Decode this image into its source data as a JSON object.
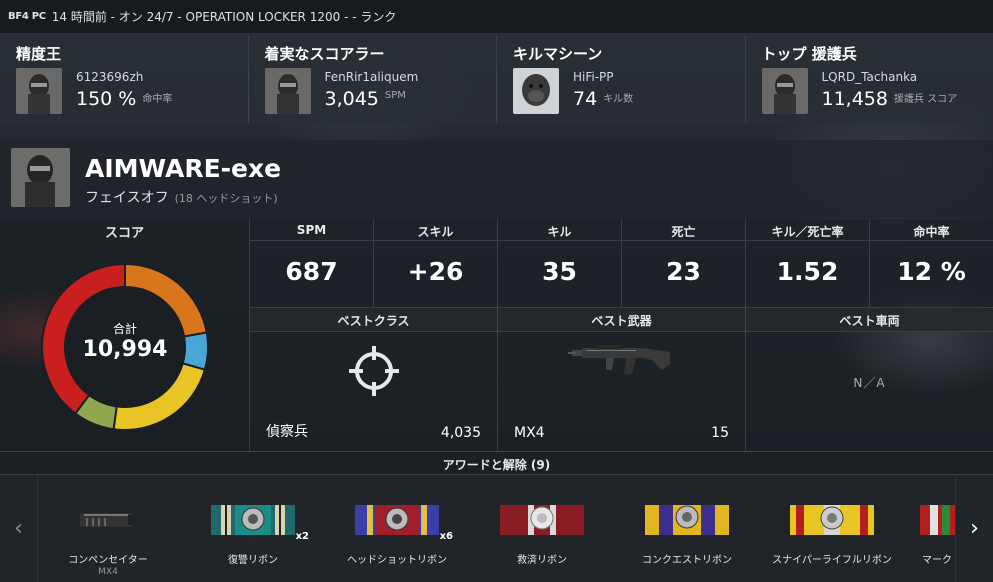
{
  "topbar": {
    "logo": "BF4 PC",
    "text": "14 時間前 - オン 24/7 - OPERATION LOCKER 1200 - - ランク"
  },
  "top_awards": [
    {
      "title": "精度王",
      "player": "6123696zh",
      "value": "150 %",
      "unit": "命中率",
      "avatar": "soldier-avatar"
    },
    {
      "title": "着実なスコアラー",
      "player": "FenRir1aliquem",
      "value": "3,045",
      "unit": "SPM",
      "avatar": "soldier-avatar"
    },
    {
      "title": "キルマシーン",
      "player": "HiFi-PP",
      "value": "74",
      "unit": "キル数",
      "avatar": "gorilla-avatar"
    },
    {
      "title": "トップ 援護兵",
      "player": "LQRD_Tachanka",
      "value": "11,458",
      "unit": "援護兵 スコア",
      "avatar": "soldier-avatar"
    }
  ],
  "player": {
    "name": "AIMWARE-exe",
    "subtitle": "フェイスオフ",
    "subtitle_note": "(18 ヘッドショット)"
  },
  "score": {
    "header": "スコア",
    "total_label": "合計",
    "total": "10,994"
  },
  "chart_data": {
    "type": "pie",
    "title": "",
    "center_label": "合計",
    "center_value": 10994,
    "slices": [
      {
        "fraction": 0.222,
        "color": "#d9761c"
      },
      {
        "fraction": 0.072,
        "color": "#4aa6d6"
      },
      {
        "fraction": 0.228,
        "color": "#e8c425"
      },
      {
        "fraction": 0.08,
        "color": "#8fa84f"
      },
      {
        "fraction": 0.398,
        "color": "#c9201f"
      }
    ]
  },
  "stats": [
    {
      "label": "SPM",
      "value": "687"
    },
    {
      "label": "スキル",
      "value": "+26"
    },
    {
      "label": "キル",
      "value": "35"
    },
    {
      "label": "死亡",
      "value": "23"
    },
    {
      "label": "キル／死亡率",
      "value": "1.52"
    },
    {
      "label": "命中率",
      "value": "12 %"
    }
  ],
  "best": {
    "class": {
      "header": "ベストクラス",
      "name": "偵察兵",
      "value": "4,035",
      "icon": "crosshair-icon"
    },
    "weapon": {
      "header": "ベスト武器",
      "name": "MX4",
      "value": "15",
      "icon": "smg-icon"
    },
    "vehicle": {
      "header": "ベスト車両",
      "na": "N／A"
    }
  },
  "awards": {
    "header": "アワードと解除 (9)",
    "items": [
      {
        "label": "コンペンセイター",
        "sub": "MX4",
        "mult": "",
        "icon": "compensator-icon"
      },
      {
        "label": "復讐リボン",
        "sub": "",
        "mult": "x2",
        "icon": "ribbon-icon"
      },
      {
        "label": "ヘッドショットリボン",
        "sub": "",
        "mult": "x6",
        "icon": "ribbon-icon"
      },
      {
        "label": "救済リボン",
        "sub": "",
        "mult": "",
        "icon": "ribbon-icon"
      },
      {
        "label": "コンクエストリボン",
        "sub": "",
        "mult": "",
        "icon": "ribbon-icon"
      },
      {
        "label": "スナイパーライフルリボン",
        "sub": "",
        "mult": "",
        "icon": "ribbon-icon"
      },
      {
        "label": "マーク",
        "sub": "",
        "mult": "",
        "icon": "ribbon-icon"
      }
    ]
  }
}
